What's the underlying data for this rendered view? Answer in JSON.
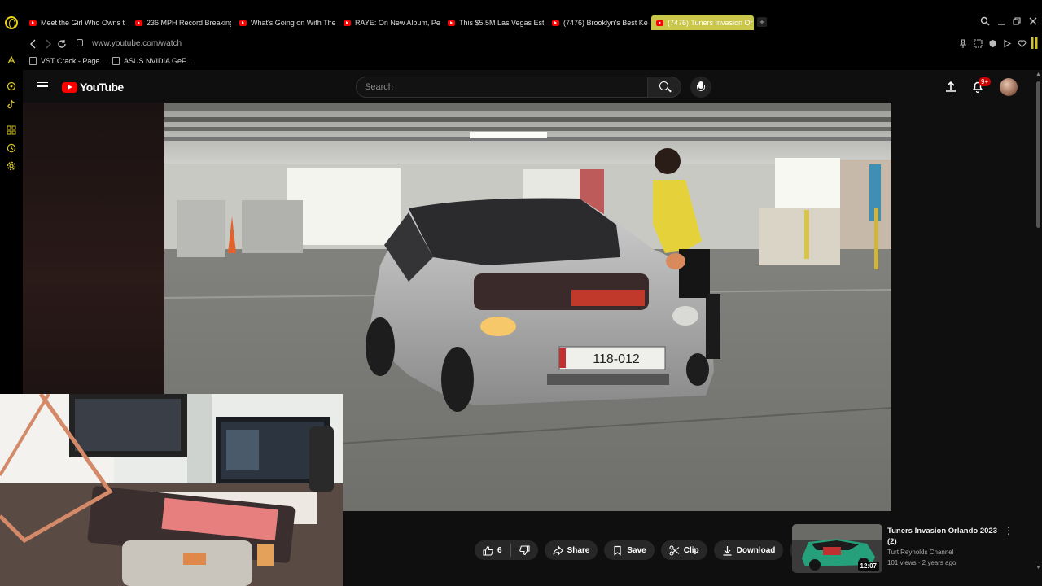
{
  "browser": {
    "tabs": [
      {
        "label": "Meet the Girl Who Owns th",
        "active": false
      },
      {
        "label": "236 MPH Record Breaking",
        "active": false
      },
      {
        "label": "What's Going on With The",
        "active": false
      },
      {
        "label": "RAYE: On New Album, Pe",
        "active": false
      },
      {
        "label": "This $5.5M Las Vegas Est",
        "active": false
      },
      {
        "label": "(7476) Brooklyn's Best Ke",
        "active": false
      },
      {
        "label": "(7476) Tuners Invasion Or",
        "active": true
      }
    ],
    "new_tab": "+",
    "url": "www.youtube.com/watch",
    "bookmarks": [
      {
        "label": "VST Crack - Page..."
      },
      {
        "label": "ASUS NVIDIA GeF..."
      }
    ],
    "accent_color": "#d6c427"
  },
  "youtube": {
    "logo_text": "YouTube",
    "search_placeholder": "Search",
    "notification_count": "9+"
  },
  "video": {
    "plate_text": "118-012"
  },
  "actions": {
    "like_count": "6",
    "share_label": "Share",
    "save_label": "Save",
    "clip_label": "Clip",
    "download_label": "Download",
    "more_label": "···"
  },
  "recommendation": {
    "title": "Tuners Invasion Orlando 2023 (2)",
    "channel": "Turt Reynolds Channel",
    "meta": "101 views · 2 years ago",
    "duration": "12:07"
  }
}
